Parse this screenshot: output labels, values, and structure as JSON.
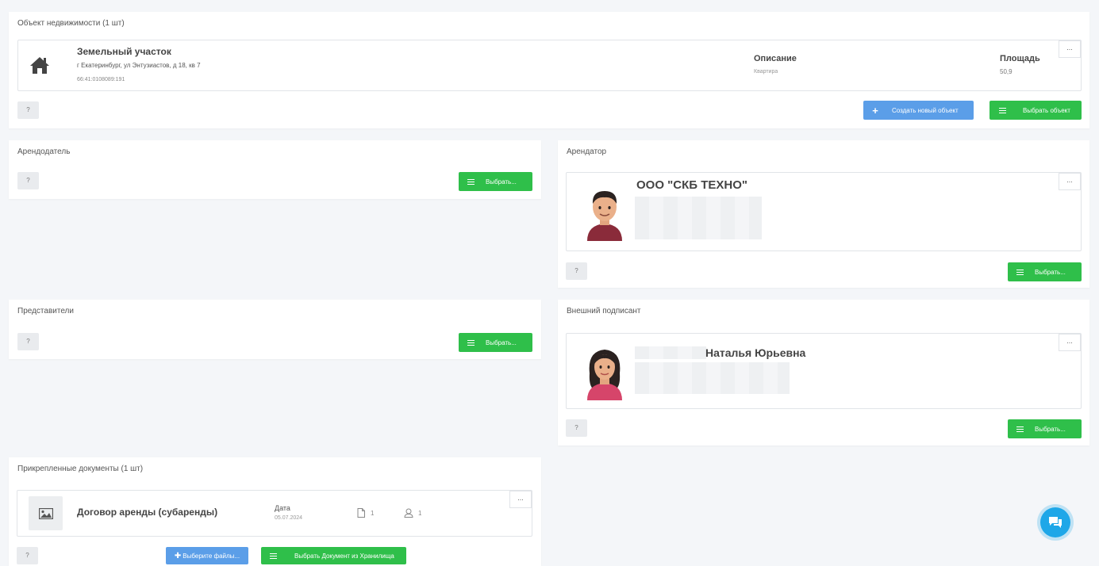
{
  "realty": {
    "title": "Объект недвижимости (1 шт)",
    "object_name": "Земельный участок",
    "address": "г Екатеринбург, ул Энтузиастов, д 18, кв 7",
    "cadastral": "66:41:0108089:191",
    "desc_label": "Описание",
    "desc_value": "Квартира",
    "area_label": "Площадь",
    "area_value": "50,9",
    "menu": "...",
    "help": "?",
    "create_btn": "Создать новый объект",
    "select_btn": "Выбрать объект"
  },
  "landlord": {
    "title": "Арендодатель",
    "help": "?",
    "select_btn": "Выбрать..."
  },
  "tenant": {
    "title": "Арендатор",
    "name": "ООО \"СКБ ТЕХНО\"",
    "menu": "...",
    "help": "?",
    "select_btn": "Выбрать..."
  },
  "representatives": {
    "title": "Представители",
    "help": "?",
    "select_btn": "Выбрать..."
  },
  "signer": {
    "title": "Внешний подписант",
    "name": "Наталья Юрьевна",
    "menu": "...",
    "help": "?",
    "select_btn": "Выбрать..."
  },
  "documents": {
    "title": "Прикрепленные документы (1 шт)",
    "doc_name": "Договор аренды (субаренды)",
    "date_label": "Дата",
    "date_value": "05.07.2024",
    "files_count": "1",
    "signers_count": "1",
    "menu": "...",
    "help": "?",
    "choose_files_btn": "Выберите файлы...",
    "storage_btn": "Выбрать Документ из Хранилища"
  },
  "colors": {
    "green": "#2fbf4a",
    "blue": "#5b9ee8",
    "chat": "#1ea7e8"
  },
  "icons": [
    "house-icon",
    "list-icon",
    "plus-icon",
    "image-icon",
    "file-icon",
    "user-icon",
    "chat-icon"
  ]
}
